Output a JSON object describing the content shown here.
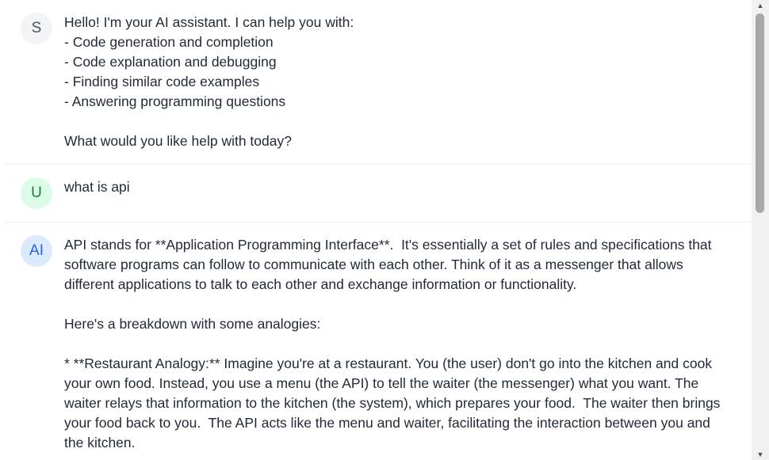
{
  "messages": [
    {
      "role": "system",
      "avatar": "S",
      "text": "Hello! I'm your AI assistant. I can help you with:\n- Code generation and completion\n- Code explanation and debugging\n- Finding similar code examples\n- Answering programming questions\n\nWhat would you like help with today?"
    },
    {
      "role": "user",
      "avatar": "U",
      "text": "what is api"
    },
    {
      "role": "ai",
      "avatar": "AI",
      "text": "API stands for **Application Programming Interface**.  It's essentially a set of rules and specifications that software programs can follow to communicate with each other. Think of it as a messenger that allows different applications to talk to each other and exchange information or functionality.\n\nHere's a breakdown with some analogies:\n\n* **Restaurant Analogy:** Imagine you're at a restaurant. You (the user) don't go into the kitchen and cook your own food. Instead, you use a menu (the API) to tell the waiter (the messenger) what you want. The waiter relays that information to the kitchen (the system), which prepares your food.  The waiter then brings your food back to you.  The API acts like the menu and waiter, facilitating the interaction between you and the kitchen."
    }
  ],
  "scrollbar": {
    "up_icon": "▲",
    "down_icon": "▼"
  }
}
